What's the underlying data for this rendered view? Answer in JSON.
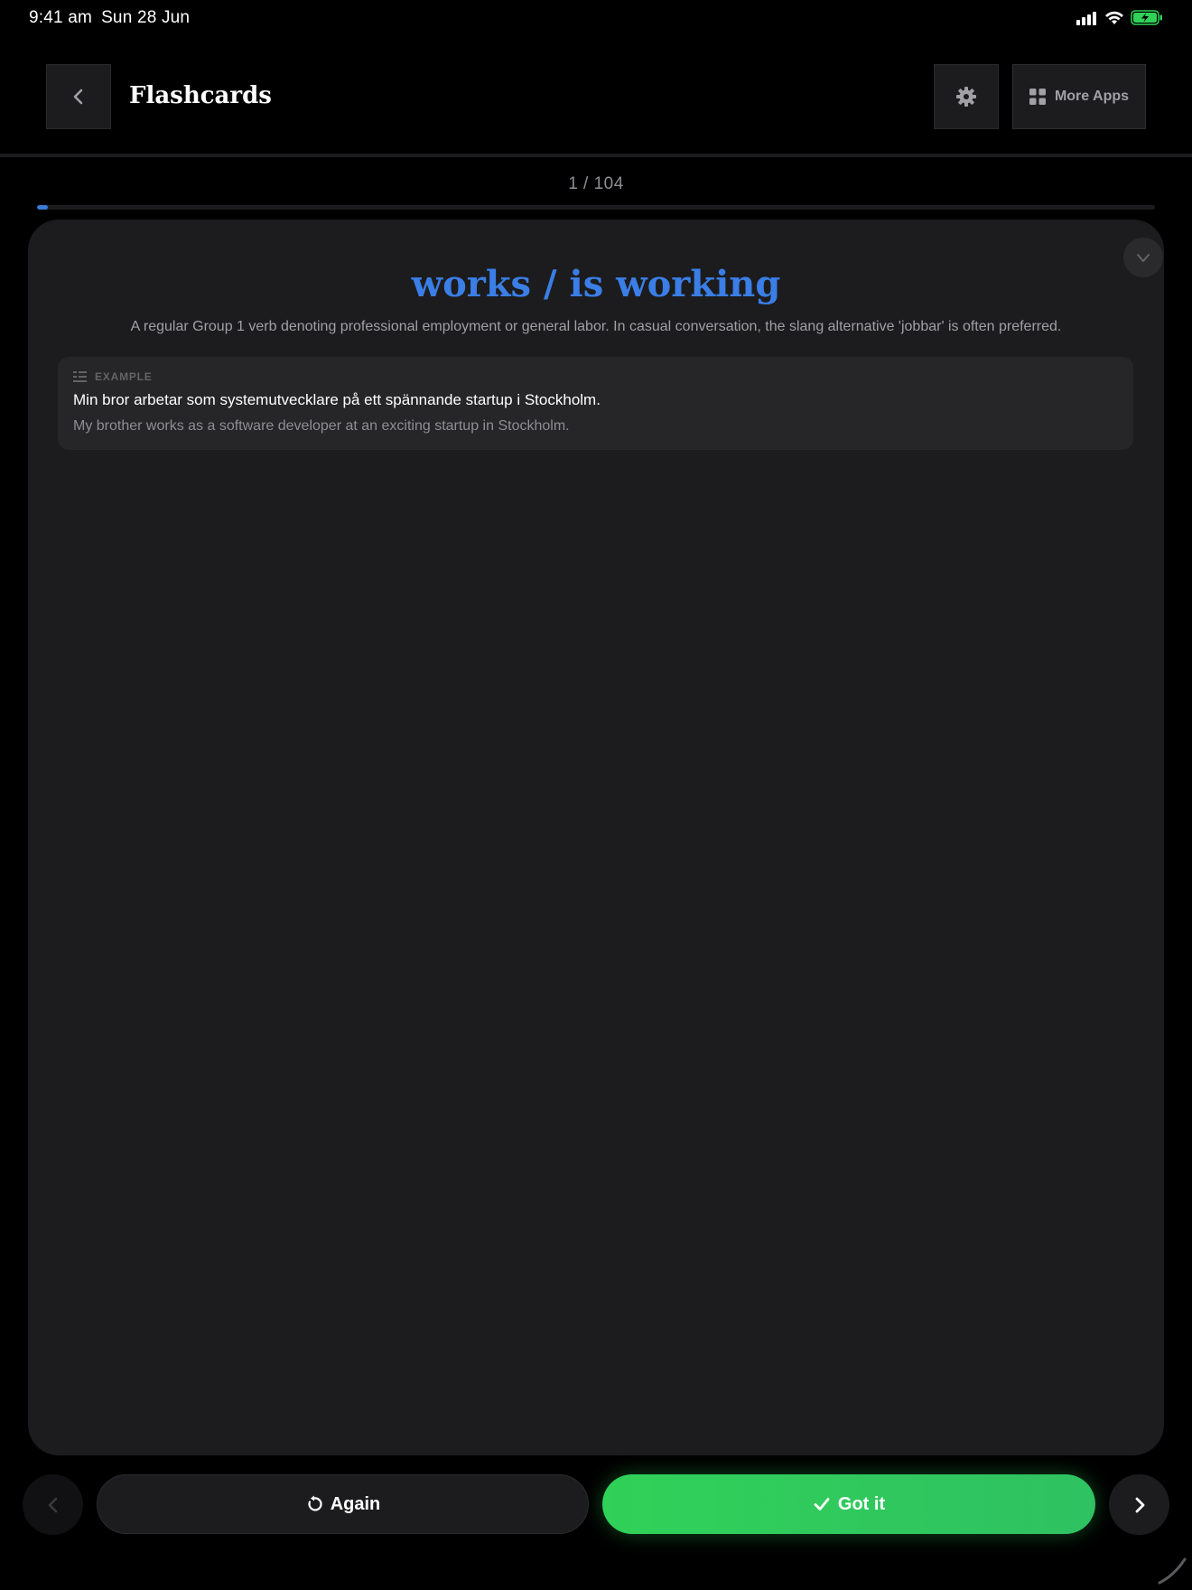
{
  "status_bar": {
    "time": "9:41 am",
    "date": "Sun 28 Jun",
    "battery_color": "#30d158"
  },
  "header": {
    "title": "Flashcards",
    "back_icon": "chevron-left-icon",
    "settings_icon": "gear-icon",
    "more_apps_label": "More Apps",
    "more_apps_icon": "grid-icon"
  },
  "progress": {
    "counter": "1 / 104",
    "current": 1,
    "total": 104,
    "fraction": 0.0096,
    "color": "#3a7bd5"
  },
  "card": {
    "word": "works / is working",
    "definition": "A regular Group 1 verb denoting professional employment or general labor. In casual conversation, the slang alternative 'jobbar' is often preferred.",
    "example": {
      "label": "EXAMPLE",
      "sentence": "Min bror arbetar som systemutvecklare på ett spännande startup i Stockholm.",
      "translation": "My brother works as a software developer at an exciting startup in Stockholm."
    },
    "word_color": "#3a7ee6"
  },
  "actions": {
    "again_label": "Again",
    "gotit_label": "Got it",
    "gotit_color": "#30d158"
  }
}
